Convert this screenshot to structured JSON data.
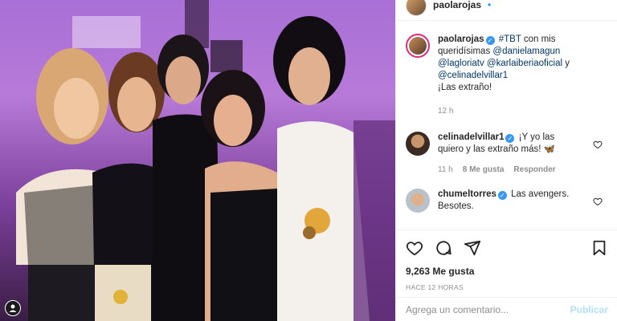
{
  "header": {
    "username": "paolarojas",
    "follow_dot": "•"
  },
  "caption": {
    "username": "paolarojas",
    "text_parts": [
      "#TBT",
      "con mis queridísimas",
      "@danielamagun",
      "@lagloriatv",
      "@karlaiberiaoficial",
      "y",
      "@celinadelvillar1",
      "¡Las extraño!"
    ],
    "time": "12 h"
  },
  "comments": [
    {
      "username": "celinadelvillar1",
      "text": "¡Y yo las quiero y las extraño más! 🦋",
      "time": "11 h",
      "likes": "8 Me gusta",
      "reply": "Responder"
    },
    {
      "username": "chumeltorres",
      "text": "Las avengers. Besotes."
    }
  ],
  "actions": {
    "likes": "9,263 Me gusta",
    "timeago": "HACE 12 HORAS"
  },
  "add_comment": {
    "placeholder": "Agrega un comentario...",
    "publish": "Publicar"
  },
  "icons": [
    "heart-icon",
    "comment-icon",
    "share-icon",
    "bookmark-icon",
    "user-icon"
  ],
  "colors": {
    "link": "#00376b",
    "verified": "#3897f0",
    "publish": "#b2dffc"
  }
}
